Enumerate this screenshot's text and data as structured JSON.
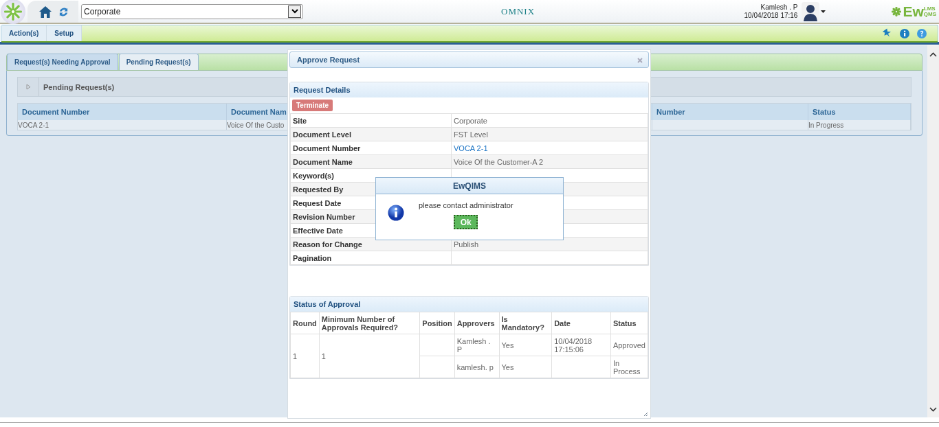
{
  "header": {
    "site_select": {
      "value": "Corporate"
    },
    "brand": "OMNIX",
    "user": {
      "name": "Kamlesh . P",
      "datetime": "10/04/2018 17:16"
    },
    "logo": {
      "main": "Ew",
      "top": "LMS",
      "bottom": "QMS"
    }
  },
  "toolbar": {
    "menus": [
      "Action(s)",
      "Setup"
    ]
  },
  "tabs": [
    {
      "label": "Request(s) Needing Approval",
      "selected": false
    },
    {
      "label": "Pending Request(s)",
      "selected": true
    }
  ],
  "pending": {
    "title": "Pending Request(s)",
    "columns": [
      "Document Number",
      "Document Nam",
      "Number",
      "Status"
    ],
    "rows": [
      {
        "document_number": "VOCA 2-1",
        "document_name": "Voice Of the Custo",
        "status": "In Progress"
      }
    ]
  },
  "approve_dialog": {
    "title": "Approve Request",
    "request_details": {
      "title": "Request Details",
      "terminate_button": "Terminate",
      "fields": [
        {
          "label": "Site",
          "value": "Corporate",
          "kind": "text"
        },
        {
          "label": "Document Level",
          "value": "FST Level",
          "kind": "text"
        },
        {
          "label": "Document Number",
          "value": "VOCA 2-1",
          "kind": "link"
        },
        {
          "label": "Document Name",
          "value": "Voice Of the Customer-A 2",
          "kind": "text"
        },
        {
          "label": "Keyword(s)",
          "kind": "text"
        },
        {
          "label": "Requested By",
          "kind": "text"
        },
        {
          "label": "Request Date",
          "kind": "text"
        },
        {
          "label": "Revision Number",
          "kind": "text"
        },
        {
          "label": "Effective Date",
          "kind": "text"
        },
        {
          "label": "Reason for Change",
          "value": "Publish",
          "kind": "text"
        },
        {
          "label": "Pagination",
          "kind": "text"
        }
      ]
    },
    "status_of_approval": {
      "title": "Status of Approval",
      "columns": [
        "Round",
        "Minimum Number of Approvals Required?",
        "Position",
        "Approvers",
        "Is Mandatory?",
        "Date",
        "Status"
      ],
      "rounds": [
        {
          "round": "1",
          "minimum": "1",
          "approvers": [
            {
              "name": "Kamlesh . P",
              "mandatory": "Yes",
              "date": "10/04/2018 17:15:06",
              "status": "Approved"
            },
            {
              "name": "kamlesh. p",
              "mandatory": "Yes",
              "status": "In Process"
            }
          ]
        }
      ]
    }
  },
  "alert": {
    "title": "EwQIMS",
    "message": "please contact administrator",
    "ok_button": "Ok"
  }
}
